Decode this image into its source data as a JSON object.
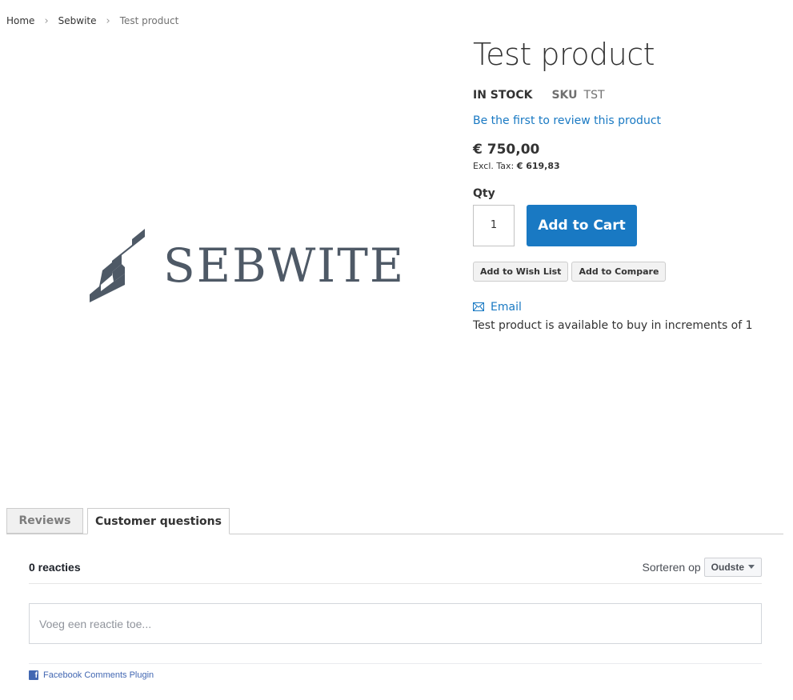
{
  "breadcrumb": {
    "items": [
      "Home",
      "Sebwite",
      "Test product"
    ]
  },
  "media": {
    "logo_text": "SEBWITE",
    "logo_color": "#4e5966"
  },
  "product": {
    "title": "Test product",
    "stock": "IN STOCK",
    "sku_label": "SKU",
    "sku_value": "TST",
    "review_link": "Be the first to review this product",
    "price": "€ 750,00",
    "excl_tax_label": "Excl. Tax:",
    "excl_tax_value": "€ 619,83",
    "qty_label": "Qty",
    "qty_value": "1",
    "add_to_cart": "Add to Cart",
    "wishlist": "Add to Wish List",
    "compare": "Add to Compare",
    "email": "Email",
    "increments": "Test product is available to buy in increments of 1"
  },
  "tabs": [
    {
      "label": "Reviews",
      "active": false
    },
    {
      "label": "Customer questions",
      "active": true
    }
  ],
  "comments": {
    "count": "0 reacties",
    "sort_label": "Sorteren op",
    "sort_value": "Oudste",
    "placeholder": "Voeg een reactie toe...",
    "plugin": "Facebook Comments Plugin",
    "fb_letter": "f"
  },
  "colors": {
    "accent": "#1979c3",
    "facebook": "#4267b2"
  },
  "icons": {
    "separator": "chevron-right-icon",
    "email": "envelope-icon",
    "sort": "caret-down-icon",
    "plugin": "facebook-icon"
  }
}
